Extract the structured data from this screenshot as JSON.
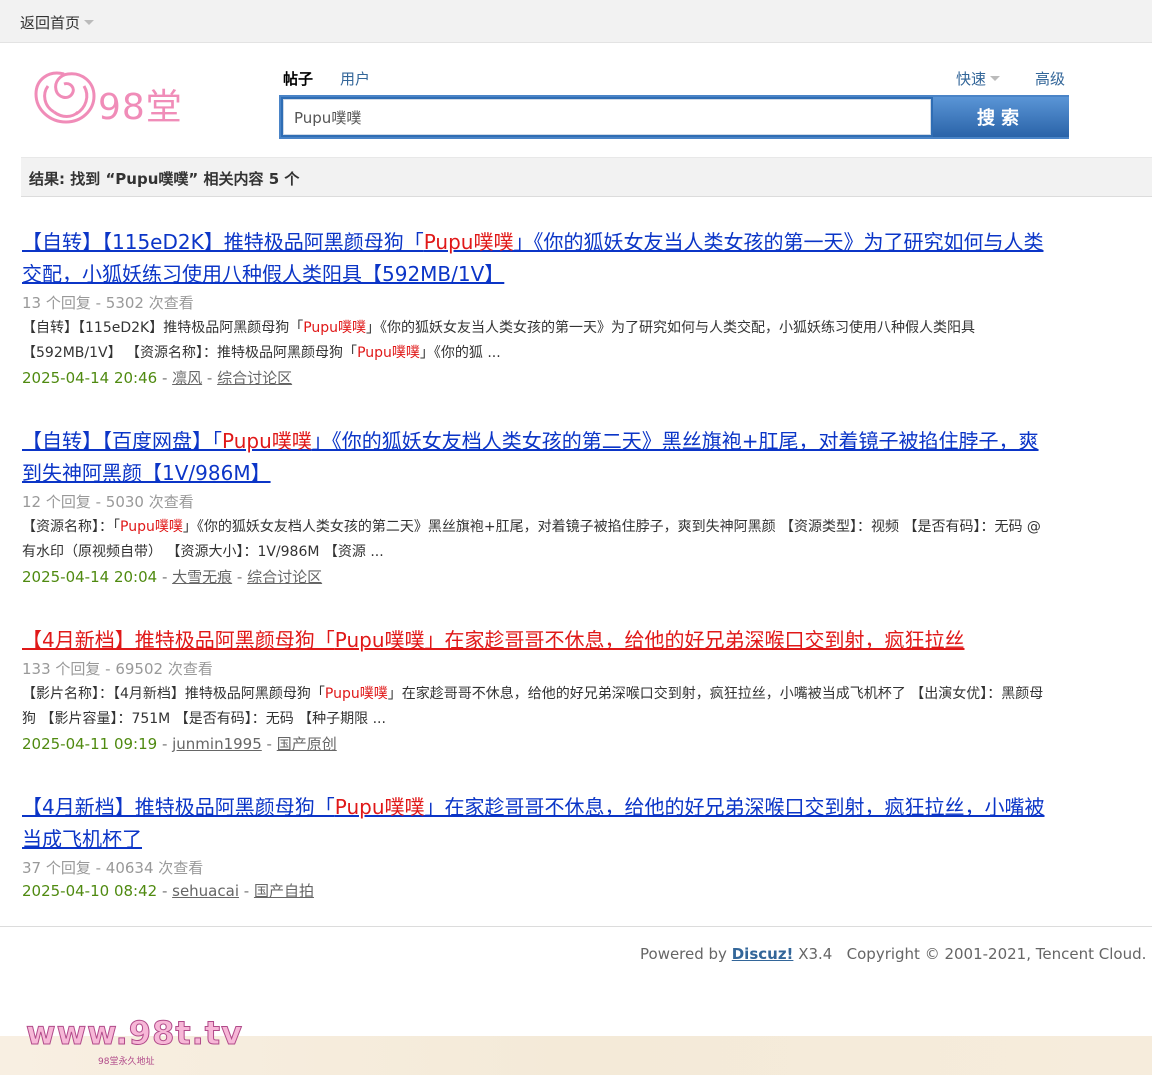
{
  "topbar": {
    "home_label": "返回首页"
  },
  "logo": {
    "text": "98堂"
  },
  "search": {
    "tabs": [
      "帖子",
      "用户"
    ],
    "quick_label": "快速",
    "advanced_label": "高级",
    "input_value": "Pupu噗噗",
    "button_label": "搜索"
  },
  "results_header": "结果: 找到 “Pupu噗噗” 相关内容 5 个",
  "results": [
    {
      "title_pre": "【自转】【115eD2K】推特极品阿黑颜母狗「",
      "title_hl": "Pupu噗噗",
      "title_post": "」《你的狐妖女友当人类女孩的第一天》为了研究如何与人类交配，小狐妖练习使用八种假人类阳具【592MB/1V】",
      "meta": "13 个回复 - 5302 次查看",
      "snip_a": "【自转】【115eD2K】推特极品阿黑颜母狗「",
      "snip_hl1": "Pupu噗噗",
      "snip_b": "」《你的狐妖女友当人类女孩的第一天》为了研究如何与人类交配，小狐妖练习使用八种假人类阳具【592MB/1V】 【资源名称】：推特极品阿黑颜母狗「",
      "snip_hl2": "Pupu噗噗",
      "snip_c": "」《你的狐 ...",
      "date": "2025-04-14 20:46",
      "author": "凛风",
      "forum": "综合讨论区"
    },
    {
      "title_pre": "【自转】【百度网盘】「",
      "title_hl": "Pupu噗噗",
      "title_post": "」《你的狐妖女友档人类女孩的第二天》黑丝旗袍+肛尾，对着镜子被掐住脖子，爽到失神阿黑颜【1V/986M】",
      "meta": "12 个回复 - 5030 次查看",
      "snip_a": "【资源名称】：「",
      "snip_hl1": "Pupu噗噗",
      "snip_b": "」《你的狐妖女友档人类女孩的第二天》黑丝旗袍+肛尾，对着镜子被掐住脖子，爽到失神阿黑颜 【资源类型】：视频 【是否有码】：无码 @ 有水印（原视频自带） 【资源大小】：1V/986M 【资源 ...",
      "date": "2025-04-14 20:04",
      "author": "大雪无痕",
      "forum": "综合讨论区"
    },
    {
      "title_pre": "【4月新档】推特极品阿黑颜母狗「",
      "title_hl": "Pupu噗噗",
      "title_post": "」在家趁哥哥不休息，给他的好兄弟深喉口交到射，疯狂拉丝",
      "meta": "133 个回复 - 69502 次查看",
      "snip_a": "【影片名称】：【4月新档】推特极品阿黑颜母狗「",
      "snip_hl1": "Pupu噗噗",
      "snip_b": "」在家趁哥哥不休息，给他的好兄弟深喉口交到射，疯狂拉丝，小嘴被当成飞机杯了 【出演女优】：黑颜母狗 【影片容量】：751M 【是否有码】：无码 【种子期限 ...",
      "date": "2025-04-11 09:19",
      "author": "junmin1995",
      "forum": "国产原创"
    },
    {
      "title_pre": "【4月新档】推特极品阿黑颜母狗「",
      "title_hl": "Pupu噗噗",
      "title_post": "」在家趁哥哥不休息，给他的好兄弟深喉口交到射，疯狂拉丝，小嘴被当成飞机杯了",
      "meta": "37 个回复 - 40634 次查看",
      "date": "2025-04-10 08:42",
      "author": "sehuacai",
      "forum": "国产自拍"
    }
  ],
  "footer": {
    "powered_by": "Powered by",
    "product": "Discuz!",
    "version": "X3.4",
    "copyright": "Copyright © 2001-2021, Tencent Cloud.",
    "sep": "|"
  },
  "watermark": {
    "text": "www.98t.tv",
    "sub": "98堂永久地址"
  }
}
